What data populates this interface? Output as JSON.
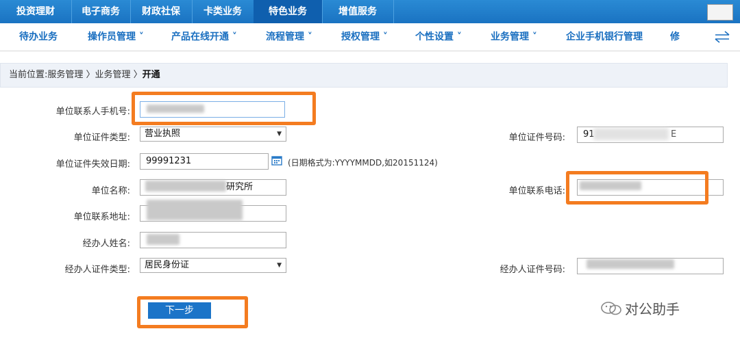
{
  "top_tabs": [
    "投资理财",
    "电子商务",
    "财政社保",
    "卡类业务",
    "特色业务",
    "增值服务"
  ],
  "sub_nav": [
    "待办业务",
    "操作员管理 ˅",
    "产品在线开通 ˅",
    "流程管理 ˅",
    "授权管理 ˅",
    "个性设置 ˅",
    "业务管理 ˅",
    "企业手机银行管理",
    "修"
  ],
  "breadcrumb": {
    "prefix": "当前位置:",
    "path": "服务管理 〉业务管理 〉",
    "current": "开通"
  },
  "form": {
    "contact_mobile_label": "单位联系人手机号:",
    "cert_type_label": "单位证件类型:",
    "cert_type_value": "营业执照",
    "cert_no_label": "单位证件号码:",
    "cert_no_prefix": "91",
    "cert_no_suffix": "E",
    "cert_expiry_label": "单位证件失效日期:",
    "cert_expiry_value": "99991231",
    "date_hint": "(日期格式为:YYYYMMDD,如20151124)",
    "unit_name_label": "单位名称:",
    "unit_name_suffix": "研究所",
    "unit_phone_label": "单位联系电话:",
    "unit_address_label": "单位联系地址:",
    "agent_name_label": "经办人姓名:",
    "agent_cert_type_label": "经办人证件类型:",
    "agent_cert_type_value": "居民身份证",
    "agent_cert_no_label": "经办人证件号码:"
  },
  "next_button": "下一步",
  "watermark": "对公助手",
  "colors": {
    "accent": "#1a73c2",
    "highlight": "#f47c20",
    "link": "#1a6fc0"
  }
}
